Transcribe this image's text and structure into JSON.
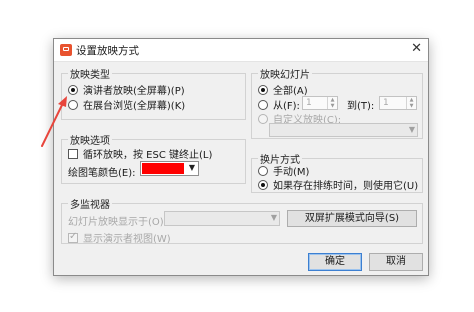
{
  "dialog": {
    "title": "设置放映方式",
    "close_glyph": "✕"
  },
  "show_type": {
    "legend": "放映类型",
    "options": [
      {
        "label": "演讲者放映(全屏幕)(P)",
        "selected": true
      },
      {
        "label": "在展台浏览(全屏幕)(K)",
        "selected": false
      }
    ]
  },
  "slides": {
    "legend": "放映幻灯片",
    "all_label": "全部(A)",
    "from_label": "从(F):",
    "from_value": "1",
    "to_label": "到(T):",
    "to_value": "1",
    "custom_label": "自定义放映(C):"
  },
  "show_options": {
    "legend": "放映选项",
    "loop_label": "循环放映，按 ESC 键终止(L)",
    "pen_color_label": "绘图笔颜色(E):",
    "pen_color": "#ff0000"
  },
  "advance": {
    "legend": "换片方式",
    "manual_label": "手动(M)",
    "timings_label": "如果存在排练时间，则使用它(U)"
  },
  "multi_monitor": {
    "legend": "多监视器",
    "display_label": "幻灯片放映显示于(O):",
    "wizard_button": "双屏扩展模式向导(S)",
    "presenter_view_label": "显示演示者视图(W)"
  },
  "footer": {
    "ok_label": "确定",
    "cancel_label": "取消"
  },
  "colors": {
    "annotation_arrow": "#e8453c"
  }
}
